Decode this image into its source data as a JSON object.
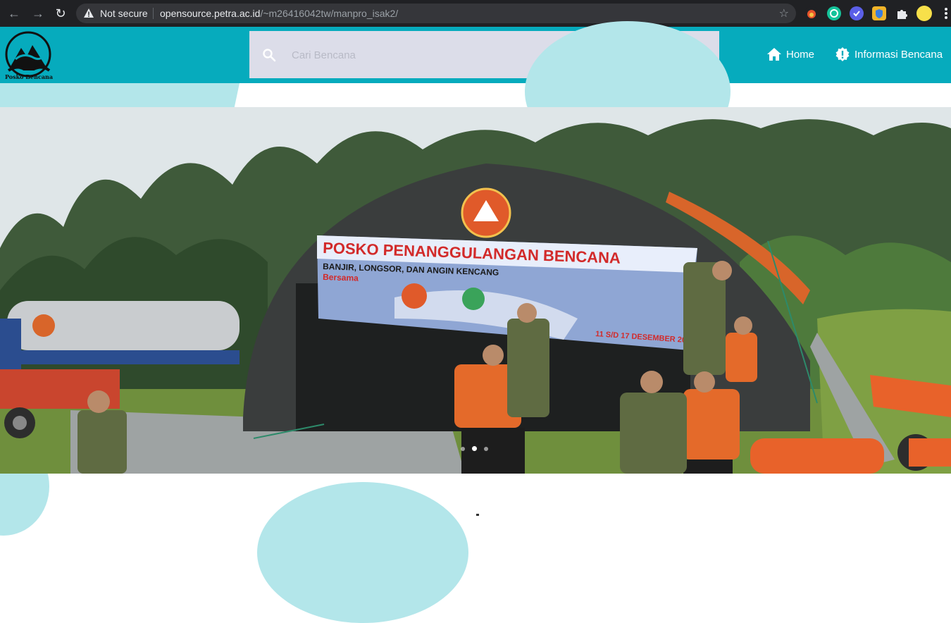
{
  "browser": {
    "security_label": "Not secure",
    "url_host": "opensource.petra.ac.id",
    "url_path": "/~m26416042tw/manpro_isak2/"
  },
  "header": {
    "logo_text": "Posko Bencana",
    "search_placeholder": "Cari Bencana",
    "nav": [
      {
        "label": "Home",
        "icon": "home-icon"
      },
      {
        "label": "Informasi Bencana",
        "icon": "alert-badge-icon"
      }
    ]
  },
  "carousel": {
    "slide_count": 3,
    "active_index": 1,
    "banner": {
      "title": "POSKO PENANGGULANGAN BENCANA",
      "subtitle": "BANJIR, LONGSOR, DAN ANGIN KENCANG",
      "tagline": "Bersama",
      "date": "11 S/D 17 DESEMBER 2017"
    }
  },
  "colors": {
    "header_bg": "#06abbd",
    "search_bg": "#dcdde9",
    "blob": "#b3e6ea"
  }
}
